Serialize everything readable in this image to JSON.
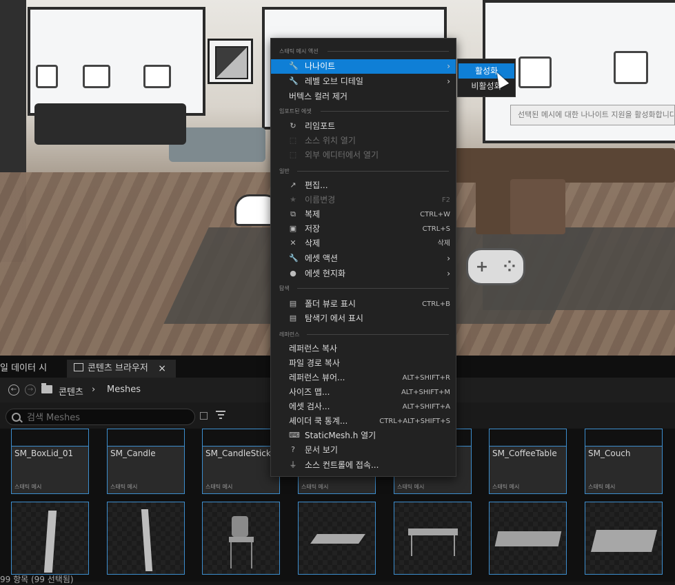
{
  "viewport": {},
  "tabs": {
    "left_partial": "일 데이터 시",
    "content_browser": "콘텐츠 브라우저",
    "close": "×"
  },
  "path": {
    "root": "콘텐츠",
    "separator": "›",
    "folder": "Meshes"
  },
  "search": {
    "placeholder": "검색 Meshes"
  },
  "assets_row1": [
    {
      "name": "SM_BoxLid_01",
      "type": "스태틱 메시"
    },
    {
      "name": "SM_Candle",
      "type": "스태틱 메시"
    },
    {
      "name": "SM_CandleStick",
      "type": "스태틱 메시"
    },
    {
      "name": "",
      "type": "스태틱 메시"
    },
    {
      "name": "",
      "type": "스태틱 메시"
    },
    {
      "name": "SM_CoffeeTable",
      "type": "스태틱 메시"
    },
    {
      "name": "SM_Couch",
      "type": "스태틱 메시"
    }
  ],
  "status": "99 항목 (99 선택됨)",
  "menu": {
    "sections": {
      "static_mesh_actions": "스태틱 메시 액션",
      "imported_asset": "임포트된 에셋",
      "common": "일반",
      "explore": "탐색",
      "references": "레퍼런스"
    },
    "items": {
      "nanite": "나나이트",
      "lod": "레벨 오브 디테일",
      "remove_vertex_colors": "버텍스 컬러 제거",
      "reimport": "리임포트",
      "show_source": "소스 위치 열기",
      "open_external": "외부 에디터에서 열기",
      "edit": "편집...",
      "rename": "이름변경",
      "rename_sc": "F2",
      "duplicate": "복제",
      "duplicate_sc": "CTRL+W",
      "save": "저장",
      "save_sc": "CTRL+S",
      "delete": "삭제",
      "delete_sc": "삭제",
      "asset_actions": "에셋 액션",
      "asset_localization": "에셋 현지화",
      "show_in_folder": "폴더 뷰로 표시",
      "show_in_folder_sc": "CTRL+B",
      "show_in_explorer": "탐색기 에서 표시",
      "copy_reference": "레퍼런스 복사",
      "copy_file_path": "파일 경로 복사",
      "reference_viewer": "레퍼런스 뷰어...",
      "reference_viewer_sc": "ALT+SHIFT+R",
      "size_map": "사이즈 맵...",
      "size_map_sc": "ALT+SHIFT+M",
      "audit_assets": "에셋 검사...",
      "audit_assets_sc": "ALT+SHIFT+A",
      "shader_cook_stats": "셰이더 쿡 통계...",
      "shader_cook_stats_sc": "CTRL+ALT+SHIFT+S",
      "open_header": "StaticMesh.h 열기",
      "view_docs": "문서 보기",
      "source_control": "소스 컨트롤에 접속..."
    },
    "arrow": "›"
  },
  "submenu": {
    "enable": "활성화",
    "disable": "비활성화"
  },
  "tooltip": "선택된 메시에 대한 나나이트 지원을 활성화합니다",
  "colors": {
    "highlight": "#0f7fd6",
    "tile_border": "#3d8fd0",
    "menu_bg": "#222222"
  }
}
